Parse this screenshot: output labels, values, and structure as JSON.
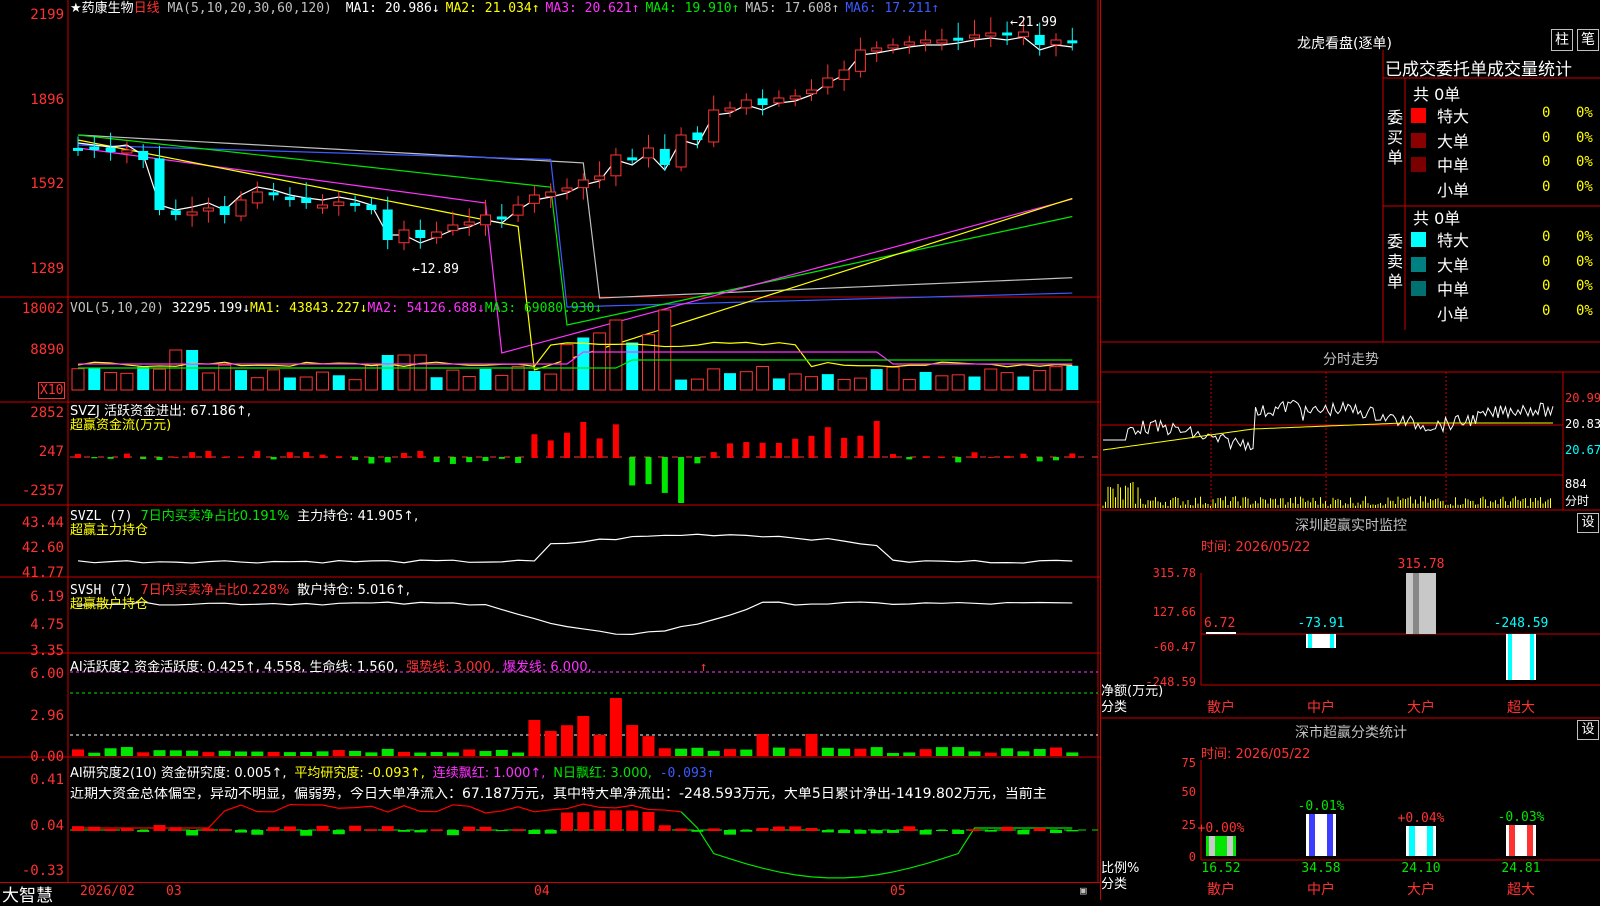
{
  "header": {
    "stock": "★药康生物",
    "period": "日线",
    "ma_params": "MA(5,10,20,30,60,120)",
    "ma": [
      {
        "name": "MA1:",
        "value": "20.986",
        "arrow": "↓",
        "color": "#ffffff"
      },
      {
        "name": "MA2:",
        "value": "21.034",
        "arrow": "↑",
        "color": "#ffff00"
      },
      {
        "name": "MA3:",
        "value": "20.621",
        "arrow": "↑",
        "color": "#ff32ff"
      },
      {
        "name": "MA4:",
        "value": "19.910",
        "arrow": "↑",
        "color": "#00e600"
      },
      {
        "name": "MA5:",
        "value": "17.608",
        "arrow": "↑",
        "color": "#c0c0c0"
      },
      {
        "name": "MA6:",
        "value": "17.211",
        "arrow": "↑",
        "color": "#3c5aff"
      }
    ],
    "high_label": "21.99",
    "low_label": "12.89"
  },
  "price_axis": [
    "2199",
    "1896",
    "1592",
    "1289"
  ],
  "vol": {
    "header": "VOL(5,10,20)",
    "value": "32295.199↓",
    "ma1": "MA1: 43843.227↓",
    "ma2": "MA2: 54126.688↓",
    "ma3": "MA3: 69080.930↓",
    "axis": [
      "18002",
      "8890"
    ],
    "unit": "X10"
  },
  "svzj": {
    "line1": "SVZJ  活跃资金进出: 67.186↑,",
    "line2": "超赢资金流(万元)",
    "axis": [
      "2852",
      "247",
      "-2357"
    ]
  },
  "svzl": {
    "p1": "SVZL (7)",
    "p2": "7日内买卖净占比0.191%",
    "p3": "主力持仓: 41.905↑,",
    "line2": "超赢主力持仓",
    "axis": [
      "43.44",
      "42.60",
      "41.77"
    ]
  },
  "svsh": {
    "p1": "SVSH (7)",
    "p2": "7日内买卖净占比0.228%",
    "p3": "散户持仓: 5.016↑,",
    "line2": "超赢散户持仓",
    "axis": [
      "6.19",
      "4.75",
      "3.35"
    ]
  },
  "ai1": {
    "p1": "AI活跃度2 资金活跃度: 0.425↑, 4.558, 生命线: 1.560,",
    "p2": "强势线: 3.000,",
    "p3": "爆发线: 6.000,",
    "p4": "↑",
    "axis": [
      "6.00",
      "2.96",
      "0.00"
    ]
  },
  "ai2": {
    "p1": "AI研究度2(10) 资金研究度: 0.005↑,",
    "p2": "平均研究度: -0.093↑,",
    "p3": "连续飘红: 1.000↑,",
    "p4": "N日飘红: 3.000,",
    "p5": "-0.093↑",
    "text": "近期大资金总体偏空，异动不明显，偏弱势，今日大单净流入：67.187万元，其中特大单净流出：-248.593万元，大单5日累计净出-1419.802万元，当前主",
    "axis": [
      "0.41",
      "0.04",
      "-0.33"
    ]
  },
  "bottom": {
    "logo": "大智慧",
    "dates": [
      "2026/02",
      "03",
      "04",
      "05"
    ]
  },
  "right": {
    "title": "龙虎看盘(逐单)",
    "btn1": "柱",
    "btn2": "笔",
    "tabs": "已成交委托单成交量统计",
    "buy": {
      "label": "委买单",
      "total": "共 0单",
      "rows": [
        {
          "name": "特大",
          "v": "0",
          "p": "0%",
          "c": "#ff0000"
        },
        {
          "name": "大单",
          "v": "0",
          "p": "0%",
          "c": "#8b0000"
        },
        {
          "name": "中单",
          "v": "0",
          "p": "0%",
          "c": "#7a0000"
        },
        {
          "name": "小单",
          "v": "0",
          "p": "0%",
          "c": ""
        }
      ]
    },
    "sell": {
      "label": "委卖单",
      "total": "共 0单",
      "rows": [
        {
          "name": "特大",
          "v": "0",
          "p": "0%",
          "c": "#00ffff"
        },
        {
          "name": "大单",
          "v": "0",
          "p": "0%",
          "c": "#008080"
        },
        {
          "name": "中单",
          "v": "0",
          "p": "0%",
          "c": "#007070"
        },
        {
          "name": "小单",
          "v": "0",
          "p": "0%",
          "c": ""
        }
      ]
    },
    "fenshi": {
      "title": "分时走势",
      "axis": [
        "20.99",
        "20.83",
        "20.67"
      ],
      "vol_label": "884",
      "vol_unit": "分时"
    },
    "monitor": {
      "title": "深圳超赢实时监控",
      "btn": "设",
      "time": "时间: 2026/05/22",
      "axis": [
        "315.78",
        "127.66",
        "-60.47",
        "-248.59"
      ],
      "ylabel": "净额(万元)",
      "xlabel": "分类",
      "cats": [
        "散户",
        "中户",
        "大户",
        "超大"
      ],
      "labels": [
        "6.72",
        "-73.91",
        "315.78",
        "-248.59"
      ]
    },
    "stats": {
      "title": "深市超赢分类统计",
      "btn": "设",
      "time": "时间: 2026/05/22",
      "axis": [
        "75",
        "50",
        "25",
        "0"
      ],
      "ylabel": "比例%",
      "xlabel": "分类",
      "cats": [
        "散户",
        "中户",
        "大户",
        "超大"
      ],
      "top": [
        "+0.00%",
        "-0.01%",
        "+0.04%",
        "-0.03%"
      ],
      "bottom": [
        "16.52",
        "34.58",
        "24.10",
        "24.81"
      ]
    }
  }
}
